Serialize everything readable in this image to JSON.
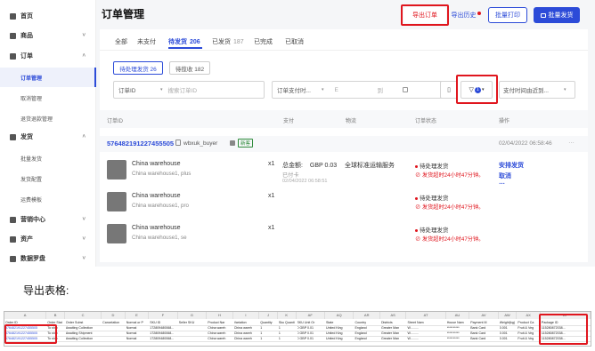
{
  "sidebar": {
    "items": [
      {
        "label": "首页",
        "icon": "home-icon",
        "type": "main"
      },
      {
        "label": "商品",
        "icon": "box-icon",
        "type": "main"
      },
      {
        "label": "订单",
        "icon": "order-icon",
        "type": "main"
      },
      {
        "label": "订单管理",
        "type": "sub",
        "active": true
      },
      {
        "label": "取消管理",
        "type": "sub"
      },
      {
        "label": "退货退款管理",
        "type": "sub"
      },
      {
        "label": "发货",
        "icon": "ship-icon",
        "type": "main"
      },
      {
        "label": "批量发货",
        "type": "sub"
      },
      {
        "label": "发货配置",
        "type": "sub"
      },
      {
        "label": "运费模板",
        "type": "sub"
      },
      {
        "label": "营销中心",
        "icon": "marketing-icon",
        "type": "main"
      },
      {
        "label": "资产",
        "icon": "asset-icon",
        "type": "main"
      },
      {
        "label": "数据罗盘",
        "icon": "data-icon",
        "type": "main"
      }
    ]
  },
  "header": {
    "title": "订单管理",
    "export_label": "导出订单",
    "history_label": "导出历史",
    "batch_print_label": "批量打印",
    "batch_ship_label": "批量发货"
  },
  "tabs": [
    {
      "label": "全部",
      "count": ""
    },
    {
      "label": "未支付",
      "count": ""
    },
    {
      "label": "待发货",
      "count": "206"
    },
    {
      "label": "已发货",
      "count": "187"
    },
    {
      "label": "已完成",
      "count": ""
    },
    {
      "label": "已取消",
      "count": ""
    }
  ],
  "subtabs": [
    {
      "label": "待处理发货 26"
    },
    {
      "label": "待揽收 182"
    }
  ],
  "filters": {
    "id_select": "订单ID",
    "id_placeholder": "搜索订单ID",
    "time_select": "订单支付时...",
    "date_from": "Ε",
    "date_sep": "到",
    "filter_count": "1",
    "sort_select": "支付时间由近到..."
  },
  "table": {
    "headers": [
      "订单ID",
      "支付",
      "物流",
      "订单状态",
      "操作"
    ]
  },
  "order": {
    "id": "576482191227455505",
    "buyer": "wbxuk_buyer",
    "badge": "新客",
    "date": "02/04/2022 06:58:46",
    "total_label": "总金额:",
    "total_value": "GBP 0.03",
    "paid_label": "已付卡",
    "paid_time": "02/04/2022 06:58:51",
    "logistics": "全球标准运输服务",
    "actions": [
      "安排发货",
      "取消"
    ],
    "products": [
      {
        "name": "China warehouse",
        "sku": "China warehouse1, plus",
        "qty": "x1",
        "status": "待处理发货",
        "warn": "发货超时24小时47分钟。"
      },
      {
        "name": "China warehouse",
        "sku": "China warehouse1, pro",
        "qty": "x1",
        "status": "待处理发货",
        "warn": "发货超时24小时47分钟。"
      },
      {
        "name": "China warehouse",
        "sku": "China warehouse1, se",
        "qty": "x1",
        "status": "待处理发货",
        "warn": "发货超时24小时47分钟。"
      }
    ]
  },
  "export_section_label": "导出表格:",
  "sheet": {
    "columns": [
      "A",
      "B",
      "C",
      "D",
      "E",
      "F",
      "G",
      "H",
      "I",
      "J",
      "K",
      "AF",
      "AQ",
      "AR",
      "AS",
      "AT",
      "AU",
      "AV",
      "AW",
      "AX",
      "AY"
    ],
    "headers": [
      "Order ID",
      "Order Stat",
      "Order Subst",
      "Cancelation",
      "Normal or P",
      "SKU ID",
      "Seller SKU",
      "Product Nar",
      "Variation",
      "Quantity",
      "Sku Quanti",
      "SKU Unit Or",
      "State",
      "Country",
      "Districts",
      "Street Nam",
      "House Nam",
      "Payment M",
      "Weight(kg)",
      "Product Ca",
      "Package ID"
    ],
    "rows": [
      [
        "576482191227455505",
        "To ship",
        "Awaiting Collection",
        "",
        "Normal",
        "172809480068...",
        "",
        "China wareh",
        "China wareh",
        "1",
        "1",
        "0 GBP 0.01",
        "United King",
        "England",
        "Greater Man",
        "W.........",
        "**********",
        "Bank Card",
        "0.001",
        "Fruit & Veg",
        "115280872038..."
      ],
      [
        "576482191227455505",
        "To ship",
        "Awaiting Shipment",
        "",
        "Normal",
        "172809480068...",
        "",
        "China wareh",
        "China wareh",
        "1",
        "1",
        "0 GBP 0.01",
        "United King",
        "England",
        "Greater Man",
        "W.........",
        "**********",
        "Bank Card",
        "0.001",
        "Fruit & Veg",
        "115280872038..."
      ],
      [
        "576482191227455505",
        "To ship",
        "Awaiting Collection",
        "",
        "Normal",
        "172809480068...",
        "",
        "China wareh",
        "China wareh",
        "1",
        "1",
        "0 GBP 0.01",
        "United King",
        "England",
        "Greater Man",
        "W.........",
        "**********",
        "Bank Card",
        "0.001",
        "Fruit & Veg",
        "115280872038..."
      ]
    ]
  }
}
